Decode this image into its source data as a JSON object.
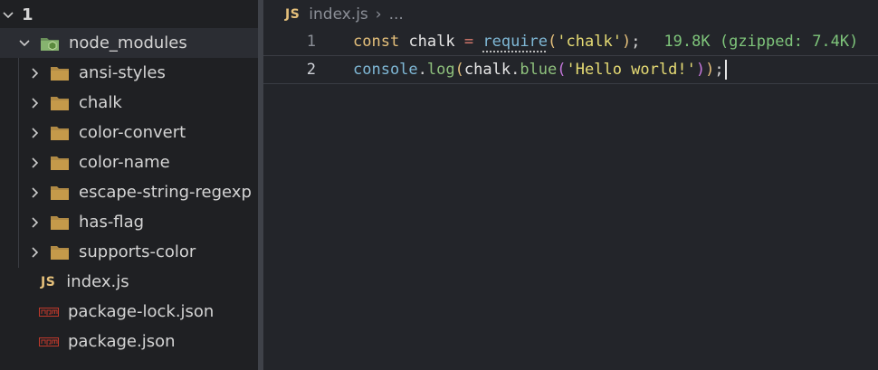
{
  "explorer": {
    "root_label": "1",
    "node_modules_label": "node_modules",
    "folders": [
      {
        "label": "ansi-styles"
      },
      {
        "label": "chalk"
      },
      {
        "label": "color-convert"
      },
      {
        "label": "color-name"
      },
      {
        "label": "escape-string-regexp"
      },
      {
        "label": "has-flag"
      },
      {
        "label": "supports-color"
      }
    ],
    "files": [
      {
        "label": "index.js",
        "badge": "JS"
      },
      {
        "label": "package-lock.json",
        "badge": "npm"
      },
      {
        "label": "package.json",
        "badge": "npm"
      }
    ]
  },
  "editor": {
    "breadcrumb": {
      "badge": "JS",
      "file": "index.js",
      "separator": "›",
      "more": "..."
    },
    "lines": [
      {
        "number": "1",
        "tokens": {
          "kw": "const",
          "name": "chalk",
          "eq": "=",
          "fn": "require",
          "open": "(",
          "str": "'chalk'",
          "close": ")",
          "semi": ";",
          "hint": "19.8K (gzipped: 7.4K)"
        }
      },
      {
        "number": "2",
        "tokens": {
          "obj": "console",
          "dot1": ".",
          "method": "log",
          "open1": "(",
          "arg": "chalk",
          "dot2": ".",
          "method2": "blue",
          "open2": "(",
          "str": "'Hello world!'",
          "close2": ")",
          "close1": ")",
          "semi": ";"
        }
      }
    ]
  },
  "colors": {
    "background": "#23252a",
    "sidebar": "#1f2023",
    "keyword": "#e5c07b",
    "string": "#e6db74",
    "size_hint": "#7ec47a",
    "folder": "#c59a4a"
  }
}
